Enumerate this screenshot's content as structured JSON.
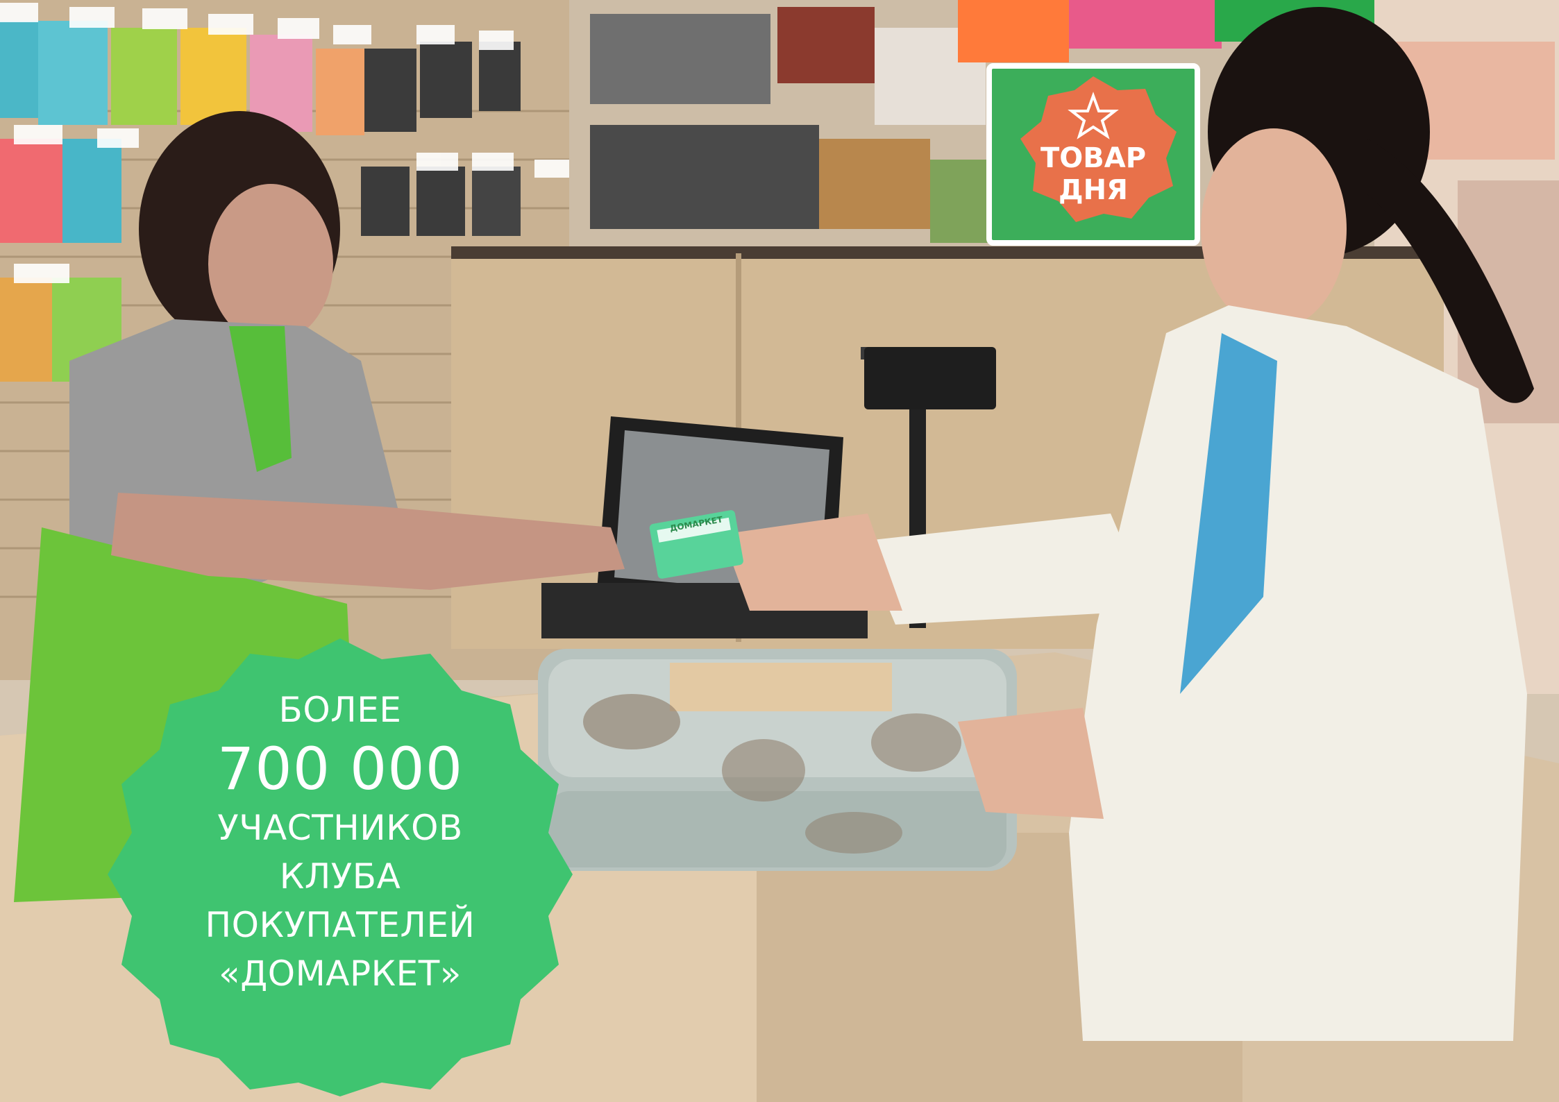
{
  "store_sign": {
    "line1": "ТОВАР",
    "line2": "ДНЯ"
  },
  "loyalty_card": {
    "brand": "ДОМАРКЕТ"
  },
  "badge": {
    "line1": "БОЛЕЕ",
    "number": "700 000",
    "line3": "УЧАСТНИКОВ",
    "line4": "КЛУБА",
    "line5": "ПОКУПАТЕЛЕЙ",
    "line6": "«ДОМАРКЕТ»"
  },
  "colors": {
    "brand_green": "#3fc470",
    "sign_orange": "#e8714a",
    "counter_wood": "#d8c2a4"
  }
}
